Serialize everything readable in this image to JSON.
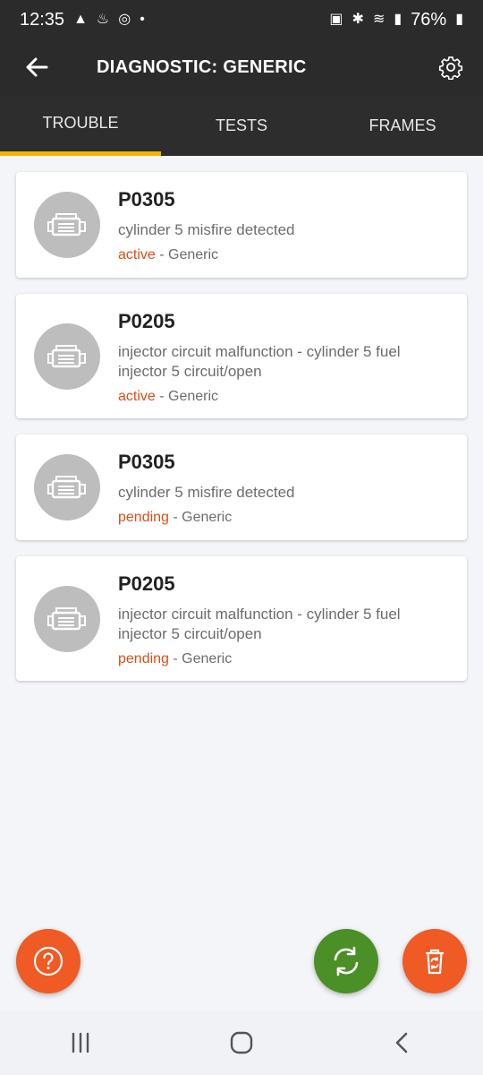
{
  "status_bar": {
    "time": "12:35",
    "battery_percent": "76%",
    "icons_left": [
      "navigation-icon",
      "notification-icon",
      "instagram-icon",
      "dot-icon"
    ],
    "icons_right": [
      "battery-saver-icon",
      "bluetooth-icon",
      "wifi-icon",
      "signal-icon",
      "battery-icon"
    ]
  },
  "app_bar": {
    "title": "DIAGNOSTIC: GENERIC",
    "back_icon": "arrow-left-icon",
    "settings_icon": "gear-icon"
  },
  "tabs": [
    {
      "label": "TROUBLE",
      "active": true
    },
    {
      "label": "TESTS",
      "active": false
    },
    {
      "label": "FRAMES",
      "active": false
    }
  ],
  "trouble_codes": [
    {
      "code": "P0305",
      "description": "cylinder 5 misfire detected",
      "state": "active",
      "source": " - Generic"
    },
    {
      "code": "P0205",
      "description": "injector circuit malfunction - cylinder 5 fuel injector 5 circuit/open",
      "state": "active",
      "source": " - Generic"
    },
    {
      "code": "P0305",
      "description": "cylinder 5 misfire detected",
      "state": "pending",
      "source": " - Generic"
    },
    {
      "code": "P0205",
      "description": "injector circuit malfunction - cylinder 5 fuel injector 5 circuit/open",
      "state": "pending",
      "source": " - Generic"
    }
  ],
  "colors": {
    "accent_tab_indicator": "#f4b400",
    "state_text": "#d84e18",
    "help_fab": "#f05a24",
    "refresh_fab": "#4b8f27",
    "delete_fab": "#f05a24"
  },
  "fabs": {
    "help_icon": "question-icon",
    "refresh_icon": "refresh-icon",
    "delete_icon": "trash-refresh-icon"
  },
  "nav_bar": {
    "recents_icon": "recents-icon",
    "home_icon": "home-icon",
    "back_icon": "chevron-left-icon"
  }
}
